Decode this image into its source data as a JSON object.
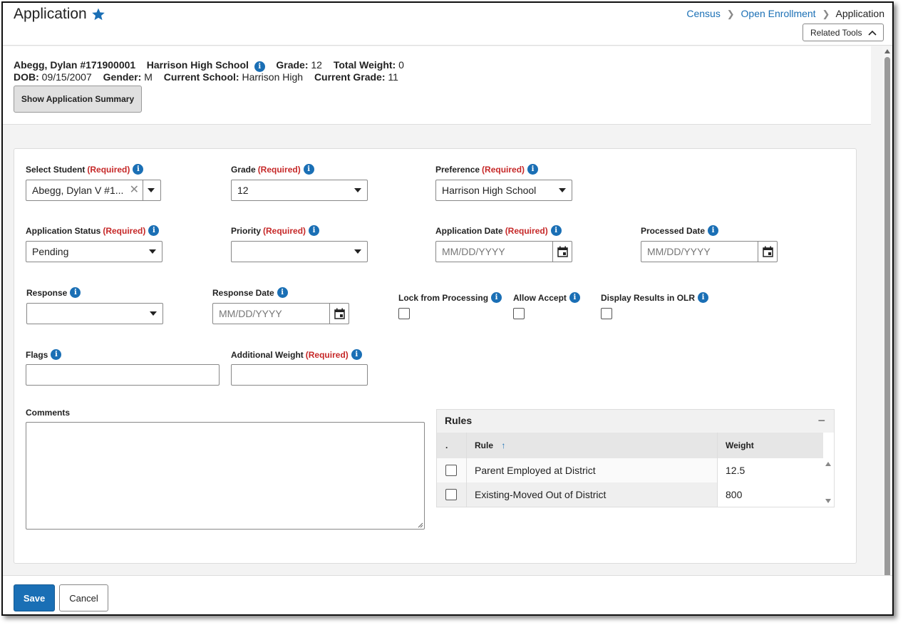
{
  "page": {
    "title": "Application",
    "breadcrumb": [
      "Census",
      "Open Enrollment",
      "Application"
    ],
    "related_tools_label": "Related Tools"
  },
  "student_header": {
    "name": "Abegg, Dylan #171900001",
    "school": "Harrison High School",
    "grade_label": "Grade:",
    "grade_value": "12",
    "total_weight_label": "Total Weight:",
    "total_weight_value": "0",
    "dob_label": "DOB:",
    "dob_value": "09/15/2007",
    "gender_label": "Gender:",
    "gender_value": "M",
    "current_school_label": "Current School:",
    "current_school_value": "Harrison High",
    "current_grade_label": "Current Grade:",
    "current_grade_value": "11",
    "summary_button": "Show Application Summary"
  },
  "form": {
    "required_tag": "(Required)",
    "select_student": {
      "label": "Select Student",
      "value": "Abegg, Dylan V #1..."
    },
    "grade": {
      "label": "Grade",
      "value": "12"
    },
    "preference": {
      "label": "Preference",
      "value": "Harrison High School"
    },
    "application_status": {
      "label": "Application Status",
      "value": "Pending"
    },
    "priority": {
      "label": "Priority",
      "value": ""
    },
    "application_date": {
      "label": "Application Date",
      "placeholder": "MM/DD/YYYY"
    },
    "processed_date": {
      "label": "Processed Date",
      "placeholder": "MM/DD/YYYY"
    },
    "response": {
      "label": "Response",
      "value": ""
    },
    "response_date": {
      "label": "Response Date",
      "placeholder": "MM/DD/YYYY"
    },
    "lock_from_processing": {
      "label": "Lock from Processing",
      "checked": false
    },
    "allow_accept": {
      "label": "Allow Accept",
      "checked": false
    },
    "display_results_olr": {
      "label": "Display Results in OLR",
      "checked": false
    },
    "flags": {
      "label": "Flags",
      "value": ""
    },
    "additional_weight": {
      "label": "Additional Weight",
      "value": ""
    },
    "comments": {
      "label": "Comments",
      "value": ""
    }
  },
  "rules": {
    "title": "Rules",
    "collapse_symbol": "−",
    "columns": {
      "select": ".",
      "rule": "Rule",
      "weight": "Weight"
    },
    "rows": [
      {
        "rule": "Parent Employed at District",
        "weight": "12.5"
      },
      {
        "rule": "Existing-Moved Out of District",
        "weight": "800"
      }
    ]
  },
  "footer": {
    "save": "Save",
    "cancel": "Cancel"
  },
  "colors": {
    "accent": "#1a6fb5",
    "required": "#c62828"
  }
}
